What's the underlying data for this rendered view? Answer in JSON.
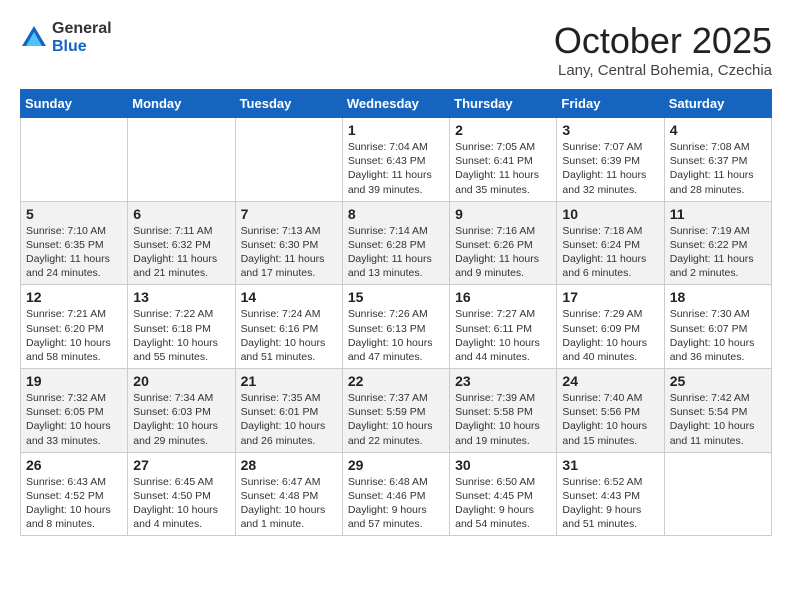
{
  "logo": {
    "general": "General",
    "blue": "Blue"
  },
  "header": {
    "month": "October 2025",
    "location": "Lany, Central Bohemia, Czechia"
  },
  "days_of_week": [
    "Sunday",
    "Monday",
    "Tuesday",
    "Wednesday",
    "Thursday",
    "Friday",
    "Saturday"
  ],
  "weeks": [
    [
      {
        "day": "",
        "info": ""
      },
      {
        "day": "",
        "info": ""
      },
      {
        "day": "",
        "info": ""
      },
      {
        "day": "1",
        "info": "Sunrise: 7:04 AM\nSunset: 6:43 PM\nDaylight: 11 hours\nand 39 minutes."
      },
      {
        "day": "2",
        "info": "Sunrise: 7:05 AM\nSunset: 6:41 PM\nDaylight: 11 hours\nand 35 minutes."
      },
      {
        "day": "3",
        "info": "Sunrise: 7:07 AM\nSunset: 6:39 PM\nDaylight: 11 hours\nand 32 minutes."
      },
      {
        "day": "4",
        "info": "Sunrise: 7:08 AM\nSunset: 6:37 PM\nDaylight: 11 hours\nand 28 minutes."
      }
    ],
    [
      {
        "day": "5",
        "info": "Sunrise: 7:10 AM\nSunset: 6:35 PM\nDaylight: 11 hours\nand 24 minutes."
      },
      {
        "day": "6",
        "info": "Sunrise: 7:11 AM\nSunset: 6:32 PM\nDaylight: 11 hours\nand 21 minutes."
      },
      {
        "day": "7",
        "info": "Sunrise: 7:13 AM\nSunset: 6:30 PM\nDaylight: 11 hours\nand 17 minutes."
      },
      {
        "day": "8",
        "info": "Sunrise: 7:14 AM\nSunset: 6:28 PM\nDaylight: 11 hours\nand 13 minutes."
      },
      {
        "day": "9",
        "info": "Sunrise: 7:16 AM\nSunset: 6:26 PM\nDaylight: 11 hours\nand 9 minutes."
      },
      {
        "day": "10",
        "info": "Sunrise: 7:18 AM\nSunset: 6:24 PM\nDaylight: 11 hours\nand 6 minutes."
      },
      {
        "day": "11",
        "info": "Sunrise: 7:19 AM\nSunset: 6:22 PM\nDaylight: 11 hours\nand 2 minutes."
      }
    ],
    [
      {
        "day": "12",
        "info": "Sunrise: 7:21 AM\nSunset: 6:20 PM\nDaylight: 10 hours\nand 58 minutes."
      },
      {
        "day": "13",
        "info": "Sunrise: 7:22 AM\nSunset: 6:18 PM\nDaylight: 10 hours\nand 55 minutes."
      },
      {
        "day": "14",
        "info": "Sunrise: 7:24 AM\nSunset: 6:16 PM\nDaylight: 10 hours\nand 51 minutes."
      },
      {
        "day": "15",
        "info": "Sunrise: 7:26 AM\nSunset: 6:13 PM\nDaylight: 10 hours\nand 47 minutes."
      },
      {
        "day": "16",
        "info": "Sunrise: 7:27 AM\nSunset: 6:11 PM\nDaylight: 10 hours\nand 44 minutes."
      },
      {
        "day": "17",
        "info": "Sunrise: 7:29 AM\nSunset: 6:09 PM\nDaylight: 10 hours\nand 40 minutes."
      },
      {
        "day": "18",
        "info": "Sunrise: 7:30 AM\nSunset: 6:07 PM\nDaylight: 10 hours\nand 36 minutes."
      }
    ],
    [
      {
        "day": "19",
        "info": "Sunrise: 7:32 AM\nSunset: 6:05 PM\nDaylight: 10 hours\nand 33 minutes."
      },
      {
        "day": "20",
        "info": "Sunrise: 7:34 AM\nSunset: 6:03 PM\nDaylight: 10 hours\nand 29 minutes."
      },
      {
        "day": "21",
        "info": "Sunrise: 7:35 AM\nSunset: 6:01 PM\nDaylight: 10 hours\nand 26 minutes."
      },
      {
        "day": "22",
        "info": "Sunrise: 7:37 AM\nSunset: 5:59 PM\nDaylight: 10 hours\nand 22 minutes."
      },
      {
        "day": "23",
        "info": "Sunrise: 7:39 AM\nSunset: 5:58 PM\nDaylight: 10 hours\nand 19 minutes."
      },
      {
        "day": "24",
        "info": "Sunrise: 7:40 AM\nSunset: 5:56 PM\nDaylight: 10 hours\nand 15 minutes."
      },
      {
        "day": "25",
        "info": "Sunrise: 7:42 AM\nSunset: 5:54 PM\nDaylight: 10 hours\nand 11 minutes."
      }
    ],
    [
      {
        "day": "26",
        "info": "Sunrise: 6:43 AM\nSunset: 4:52 PM\nDaylight: 10 hours\nand 8 minutes."
      },
      {
        "day": "27",
        "info": "Sunrise: 6:45 AM\nSunset: 4:50 PM\nDaylight: 10 hours\nand 4 minutes."
      },
      {
        "day": "28",
        "info": "Sunrise: 6:47 AM\nSunset: 4:48 PM\nDaylight: 10 hours\nand 1 minute."
      },
      {
        "day": "29",
        "info": "Sunrise: 6:48 AM\nSunset: 4:46 PM\nDaylight: 9 hours\nand 57 minutes."
      },
      {
        "day": "30",
        "info": "Sunrise: 6:50 AM\nSunset: 4:45 PM\nDaylight: 9 hours\nand 54 minutes."
      },
      {
        "day": "31",
        "info": "Sunrise: 6:52 AM\nSunset: 4:43 PM\nDaylight: 9 hours\nand 51 minutes."
      },
      {
        "day": "",
        "info": ""
      }
    ]
  ]
}
